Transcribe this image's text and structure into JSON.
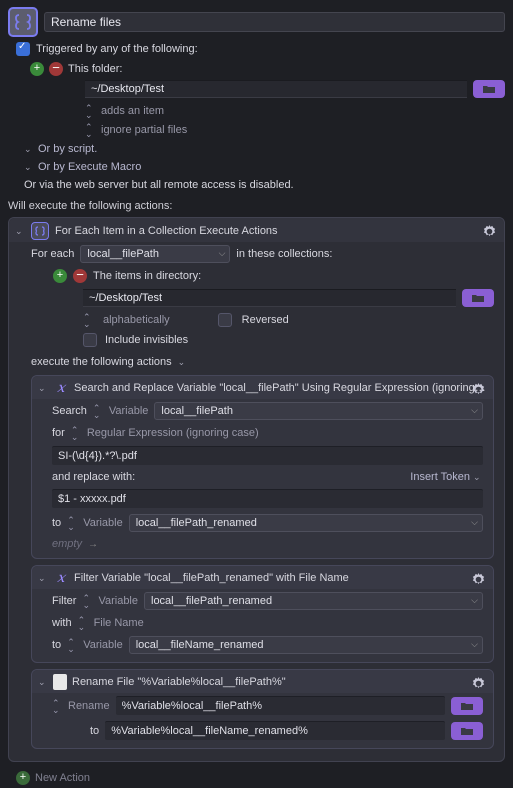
{
  "title": "Rename files",
  "trigger": {
    "label": "Triggered by any of the following:",
    "folder_label": "This folder:",
    "folder_path": "~/Desktop/Test",
    "adds_item": "adds an item",
    "ignore_partial": "ignore partial files",
    "or_by_script": "Or by script.",
    "or_by_macro": "Or by Execute Macro",
    "or_web": "Or via the web server but all remote access is disabled."
  },
  "exec_header": "Will execute the following actions:",
  "foreach": {
    "title": "For Each Item in a Collection Execute Actions",
    "for_each": "For each",
    "var_name": "local__filePath",
    "in_collections": "in these collections:",
    "items_dir": "The items in directory:",
    "dir_path": "~/Desktop/Test",
    "alphabetically": "alphabetically",
    "reversed": "Reversed",
    "include_inv": "Include invisibles",
    "execute_following": "execute the following actions"
  },
  "search_replace": {
    "title": "Search and Replace Variable \"local__filePath\" Using Regular Expression (ignoring case)",
    "search": "Search",
    "variable": "Variable",
    "var_name": "local__filePath",
    "for": "for",
    "regex_label": "Regular Expression (ignoring case)",
    "pattern": "SI-(\\d{4}).*?\\.pdf",
    "replace_with": "and replace with:",
    "insert_token": "Insert Token",
    "replacement": "$1 - xxxxx.pdf",
    "to": "to",
    "to_variable": "Variable",
    "to_var_name": "local__filePath_renamed",
    "empty": "empty"
  },
  "filter": {
    "title": "Filter Variable \"local__filePath_renamed\" with File Name",
    "filter": "Filter",
    "variable": "Variable",
    "var_name": "local__filePath_renamed",
    "with": "with",
    "file_name": "File Name",
    "to": "to",
    "to_variable": "Variable",
    "to_var_name": "local__fileName_renamed"
  },
  "rename": {
    "title": "Rename File \"%Variable%local__filePath%\"",
    "rename": "Rename",
    "rename_val": "%Variable%local__filePath%",
    "to": "to",
    "to_val": "%Variable%local__fileName_renamed%"
  },
  "new_action": "New Action"
}
